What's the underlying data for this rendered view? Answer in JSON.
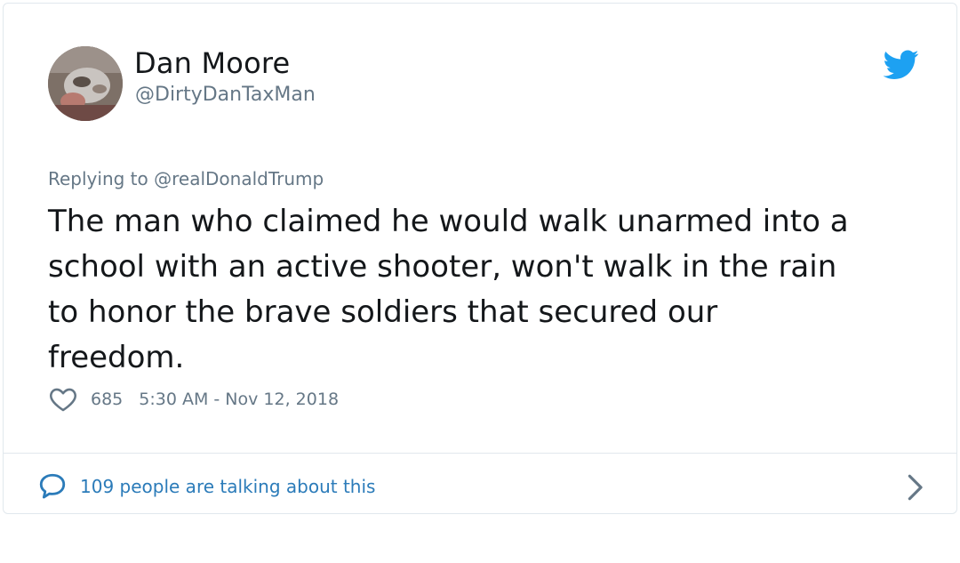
{
  "author": {
    "name": "Dan Moore",
    "handle": "@DirtyDanTaxMan"
  },
  "reply": {
    "prefix": "Replying to",
    "mention": "@realDonaldTrump"
  },
  "tweet": {
    "text": "The man who claimed he would walk unarmed into a\nschool with an active shooter, won't walk in the rain\nto honor the brave soldiers that secured our\nfreedom."
  },
  "meta": {
    "likes": "685",
    "timestamp": "5:30 AM - Nov 12, 2018"
  },
  "footer": {
    "talking": "109 people are talking about this"
  },
  "icons": {
    "brand": "twitter-bird-icon",
    "like": "heart-outline-icon",
    "reply": "speech-bubble-icon",
    "more": "chevron-right-icon"
  },
  "colors": {
    "twitter_blue": "#1da1f2",
    "link_blue": "#2b7bb9",
    "secondary_text": "#657786",
    "primary_text": "#14171a",
    "border": "#e1e8ed"
  }
}
